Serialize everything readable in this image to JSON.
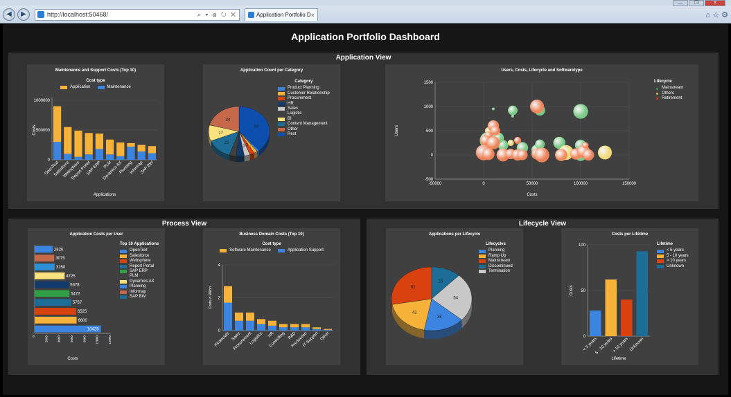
{
  "browser": {
    "url": "http://localhost:50468/",
    "tab_title": "Application Portfolio Dashb...",
    "tab_close": "×",
    "back": "◀",
    "forward": "▶",
    "address_tools": "⌕ ▾ ⊠ ↻ ✕",
    "right_tools": "⌂ ☆ ⚙",
    "minimize": "—",
    "maximize": "❐",
    "close": "✕"
  },
  "dashboard": {
    "title": "Application Portfolio Dashboard",
    "sections": {
      "application_view": "Application View",
      "process_view": "Process View",
      "lifecycle_view": "Lifecycle View"
    }
  },
  "colors": {
    "orange": "#f7b23a",
    "blue": "#3b85e0",
    "red": "#d9410f",
    "navy": "#123a6b",
    "gray": "#c8c8c8",
    "yellow": "#f9e27d",
    "teal": "#1c6e99",
    "brown": "#c6694a",
    "darkblue": "#0d4fae",
    "green": "#2f9e44",
    "lightgreen": "#7fd18b",
    "salmon": "#f4865c"
  },
  "chart_data": [
    {
      "id": "maint",
      "type": "bar",
      "stacked": true,
      "title": "Maintenance and Support Costs (Top 10)",
      "legend_title": "Cost type",
      "categories": [
        "OpenText",
        "Salesforce",
        "Websphere",
        "Report Portal",
        "SAP ERP",
        "PLM",
        "Dynamics AX",
        "Planning",
        "Informap",
        "SAP BW"
      ],
      "series": [
        {
          "name": "Application",
          "color": "#f7b23a",
          "values": [
            600000,
            450000,
            440000,
            360000,
            260000,
            250000,
            230000,
            60000,
            110000,
            120000
          ]
        },
        {
          "name": "Maintenance",
          "color": "#3b85e0",
          "values": [
            300000,
            100000,
            50000,
            90000,
            180000,
            90000,
            60000,
            220000,
            140000,
            110000
          ]
        }
      ],
      "ylim": [
        0,
        1000000
      ],
      "yticks": [
        "0",
        "500000",
        "1000000"
      ],
      "ylabel": "Costs",
      "xlabel": "Applications"
    },
    {
      "id": "appcount",
      "type": "pie",
      "title": "Application Count per Category",
      "legend_title": "Category",
      "slices": [
        {
          "label": "Product Planning",
          "value": 2,
          "color": "#3b85e0"
        },
        {
          "label": "Customer Relationship",
          "value": 3,
          "color": "#f7b23a"
        },
        {
          "label": "Procurement",
          "value": 4,
          "color": "#d9410f"
        },
        {
          "label": "HR",
          "value": 7,
          "color": "#123a6b"
        },
        {
          "label": "Sales",
          "value": 5,
          "color": "#c8c8c8"
        },
        {
          "label": "Logistic",
          "value": 6,
          "color": "#404040"
        },
        {
          "label": "BI",
          "value": 17,
          "color": "#f9e27d"
        },
        {
          "label": "Content Management",
          "value": 22,
          "color": "#1c6e99"
        },
        {
          "label": "Other",
          "value": 34,
          "color": "#c6694a"
        },
        {
          "label": "Rest",
          "value": 63,
          "color": "#0d4fae"
        }
      ],
      "shown_labels": [
        "63",
        "22",
        "34",
        "17",
        "3",
        "1",
        "7",
        "2"
      ]
    },
    {
      "id": "bubble",
      "type": "scatter",
      "title": "Users, Costs, Lifecycle and Softwaretype",
      "legend_title": "Lifecycle",
      "series": [
        {
          "name": "Mainstream",
          "color": "#7fd18b",
          "points": [
            [
              10000,
              950,
              3
            ],
            [
              30000,
              800,
              3
            ],
            [
              30000,
              920,
              11
            ],
            [
              58000,
              920,
              12
            ],
            [
              100000,
              900,
              17
            ],
            [
              5000,
              300,
              20
            ],
            [
              20000,
              200,
              12
            ],
            [
              40000,
              150,
              13
            ],
            [
              78000,
              250,
              14
            ],
            [
              100000,
              200,
              13
            ],
            [
              55000,
              100,
              13
            ],
            [
              58000,
              220,
              11
            ],
            [
              80000,
              0,
              14
            ],
            [
              100000,
              0,
              14
            ],
            [
              15000,
              350,
              13
            ],
            [
              20000,
              50,
              11
            ]
          ]
        },
        {
          "name": "Others",
          "color": "#f9e27d",
          "points": [
            [
              5000,
              500,
              8
            ],
            [
              28000,
              250,
              7
            ],
            [
              125000,
              50,
              16
            ],
            [
              85000,
              50,
              17
            ]
          ]
        },
        {
          "name": "Retirement",
          "color": "#f4865c",
          "points": [
            [
              55000,
              1000,
              16
            ],
            [
              10000,
              600,
              13
            ],
            [
              12000,
              500,
              11
            ],
            [
              5000,
              400,
              9
            ],
            [
              2000,
              300,
              12
            ],
            [
              10000,
              250,
              15
            ],
            [
              0,
              50,
              18
            ],
            [
              5000,
              20,
              14
            ],
            [
              20000,
              0,
              15
            ],
            [
              28000,
              20,
              12
            ],
            [
              35000,
              0,
              13
            ],
            [
              40000,
              0,
              12
            ],
            [
              55000,
              20,
              13
            ],
            [
              60000,
              0,
              17
            ],
            [
              80000,
              0,
              14
            ],
            [
              95000,
              20,
              13
            ],
            [
              103000,
              70,
              15
            ],
            [
              108000,
              0,
              13
            ],
            [
              105000,
              200,
              7
            ],
            [
              35000,
              300,
              8
            ]
          ]
        }
      ],
      "xlim": [
        -50000,
        150000
      ],
      "ylim": [
        -500,
        1500
      ],
      "xticks": [
        "-50000",
        "0",
        "50000",
        "100000",
        "150000"
      ],
      "yticks": [
        "-500",
        "0",
        "500",
        "1000",
        "1500"
      ],
      "xlabel": "Costs",
      "ylabel": "Users"
    },
    {
      "id": "costuser",
      "type": "bar",
      "orientation": "horizontal",
      "title": "Application Costs per User",
      "legend_title": "Top 10 Applications",
      "items": [
        {
          "label": "OpenText",
          "value": 2826,
          "color": "#3b85e0"
        },
        {
          "label": "Salesforce",
          "value": 3075,
          "color": "#c6694a"
        },
        {
          "label": "Websphere",
          "value": 3150,
          "color": "#2d8fd6"
        },
        {
          "label": "Report Portal",
          "value": 4725,
          "color": "#f9e27d"
        },
        {
          "label": "SAP ERP",
          "value": 5378,
          "color": "#123a6b"
        },
        {
          "label": "PLM",
          "value": 5472,
          "color": "#2f9e44"
        },
        {
          "label": "Dynamics AX",
          "value": 5767,
          "color": "#1c6e99"
        },
        {
          "label": "Planning",
          "value": 6525,
          "color": "#d9410f"
        },
        {
          "label": "Informap",
          "value": 6600,
          "color": "#f7b23a"
        },
        {
          "label": "SAP BW",
          "value": 10425,
          "color": "#3b85e0"
        }
      ],
      "legend_colors": [
        "#3b85e0",
        "#f7b23a",
        "#d9410f",
        "#1c6e99",
        "#2f9e44",
        "#404040",
        "#f9e27d",
        "#3b85e0",
        "#c6694a",
        "#1c6e99"
      ],
      "xlim": [
        0,
        12000
      ],
      "xticks": [
        "0",
        "2000",
        "4000",
        "6000",
        "8000",
        "10000",
        "12000"
      ],
      "xlabel": "Costs"
    },
    {
      "id": "domain",
      "type": "bar",
      "stacked": true,
      "title": "Business Domain Costs (Top 10)",
      "legend_title": "Cost type",
      "categories": [
        "Financials",
        "Sales",
        "Procurement",
        "Logistics",
        "HR",
        "Controlling",
        "R&D",
        "Production",
        "IT Support",
        "Other"
      ],
      "series": [
        {
          "name": "Software Maintenance",
          "color": "#f7b23a",
          "values": [
            1.0,
            0.5,
            0.5,
            0.3,
            0.3,
            0.2,
            0.2,
            0.2,
            0.1,
            0.05
          ]
        },
        {
          "name": "Application Support",
          "color": "#3b85e0",
          "values": [
            1.7,
            0.6,
            0.6,
            0.4,
            0.3,
            0.2,
            0.2,
            0.2,
            0.1,
            0.05
          ]
        }
      ],
      "ylim": [
        0,
        4
      ],
      "yticks": [
        "0",
        "2",
        "4"
      ],
      "ylabel": "Costs in Millon"
    },
    {
      "id": "applife",
      "type": "pie",
      "title": "Applications per Lifecycle",
      "legend_title": "Lifecycles",
      "slices": [
        {
          "label": "Planning",
          "value": 36,
          "color": "#3b85e0"
        },
        {
          "label": "Ramp Up",
          "value": 42,
          "color": "#f7b23a"
        },
        {
          "label": "Mainstream",
          "value": 61,
          "color": "#d9410f"
        },
        {
          "label": "Discontinued",
          "value": 26,
          "color": "#1c6e99"
        },
        {
          "label": "Termination",
          "value": 54,
          "color": "#c8c8c8"
        }
      ]
    },
    {
      "id": "lifetime",
      "type": "bar",
      "title": "Costs per Lifetime",
      "legend_title": "Lifetime",
      "categories": [
        "< 5 years",
        "5 - 10 years",
        "> 10 years",
        "Unknown"
      ],
      "values": [
        28,
        62,
        40,
        93
      ],
      "colors": [
        "#3b85e0",
        "#f7b23a",
        "#d9410f",
        "#1c6e99"
      ],
      "ylim": [
        0,
        100
      ],
      "yticks": [
        "0",
        "50",
        "100"
      ],
      "ylabel": "Costs",
      "xlabel": "Lifetime"
    }
  ]
}
